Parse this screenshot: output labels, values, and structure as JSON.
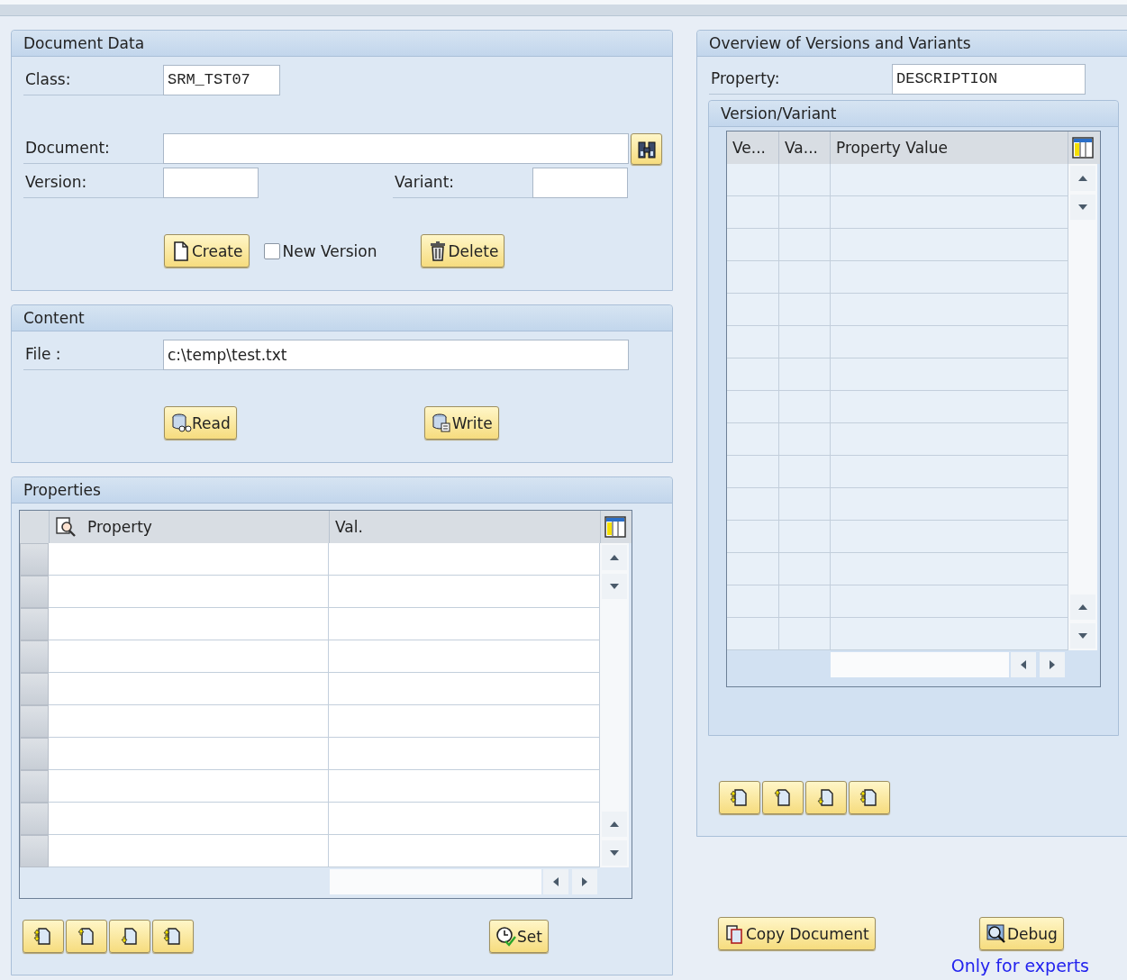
{
  "document_data": {
    "title": "Document Data",
    "class": {
      "label": "Class:",
      "value": "SRM_TST07"
    },
    "document": {
      "label": "Document:"
    },
    "version": {
      "label": "Version:"
    },
    "variant": {
      "label": "Variant:"
    },
    "buttons": [
      {
        "label": "Create"
      },
      {
        "label": "Delete"
      }
    ],
    "new_version": {
      "label": "New Version",
      "checked": false
    }
  },
  "content": {
    "title": "Content",
    "file": {
      "label": "File :",
      "value": "c:\\temp\\test.txt"
    },
    "buttons": [
      {
        "label": "Read"
      },
      {
        "label": "Write"
      }
    ]
  },
  "properties": {
    "title": "Properties",
    "columns": [
      "Property",
      "Val."
    ],
    "rows": [
      {
        "selected": false
      },
      {
        "selected": false
      },
      {
        "selected": false
      },
      {
        "selected": false
      },
      {
        "selected": false
      },
      {
        "selected": false
      },
      {
        "selected": false
      },
      {
        "selected": false
      },
      {
        "selected": false
      },
      {
        "selected": false
      }
    ],
    "set_button": "Set"
  },
  "overview": {
    "title": "Overview of Versions and Variants",
    "property": {
      "label": "Property:",
      "value": "DESCRIPTION"
    },
    "version_variant": {
      "title": "Version/Variant",
      "columns": [
        "Ve...",
        "Va...",
        "Property Value"
      ]
    }
  },
  "copy_button": "Copy Document",
  "debug_button": "Debug",
  "debug_hint": "Only for experts"
}
